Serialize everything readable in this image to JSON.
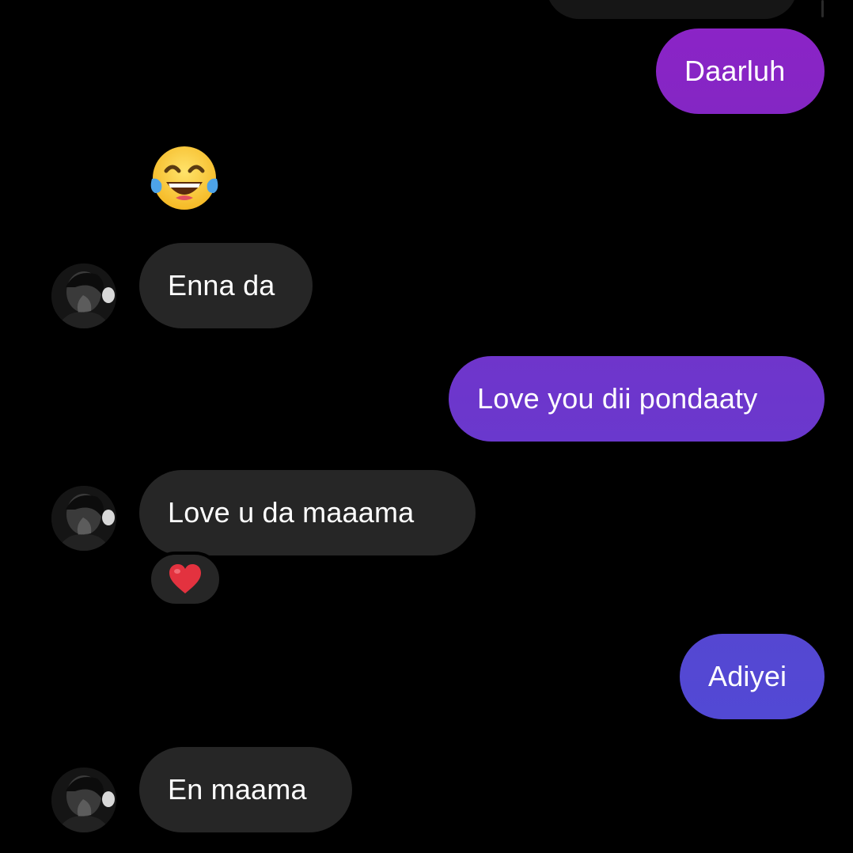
{
  "colors": {
    "background": "#000000",
    "incoming_bubble": "#262626",
    "outgoing_gradient_top": "#8a24c4",
    "outgoing_gradient_mid": "#6c36cc",
    "outgoing_gradient_bottom": "#5548d2",
    "text": "#ffffff"
  },
  "messages": [
    {
      "id": "m1",
      "direction": "outgoing",
      "text": "Daarluh"
    },
    {
      "id": "m2",
      "direction": "incoming",
      "type": "emoji",
      "emoji": "face-with-tears-of-joy-icon"
    },
    {
      "id": "m3",
      "direction": "incoming",
      "text": "Enna da"
    },
    {
      "id": "m4",
      "direction": "outgoing",
      "text": "Love you dii pondaaty"
    },
    {
      "id": "m5",
      "direction": "incoming",
      "text": "Love u da maaama",
      "reaction": "red-heart-icon"
    },
    {
      "id": "m6",
      "direction": "outgoing",
      "text": "Adiyei"
    },
    {
      "id": "m7",
      "direction": "incoming",
      "text": "En maama"
    }
  ]
}
